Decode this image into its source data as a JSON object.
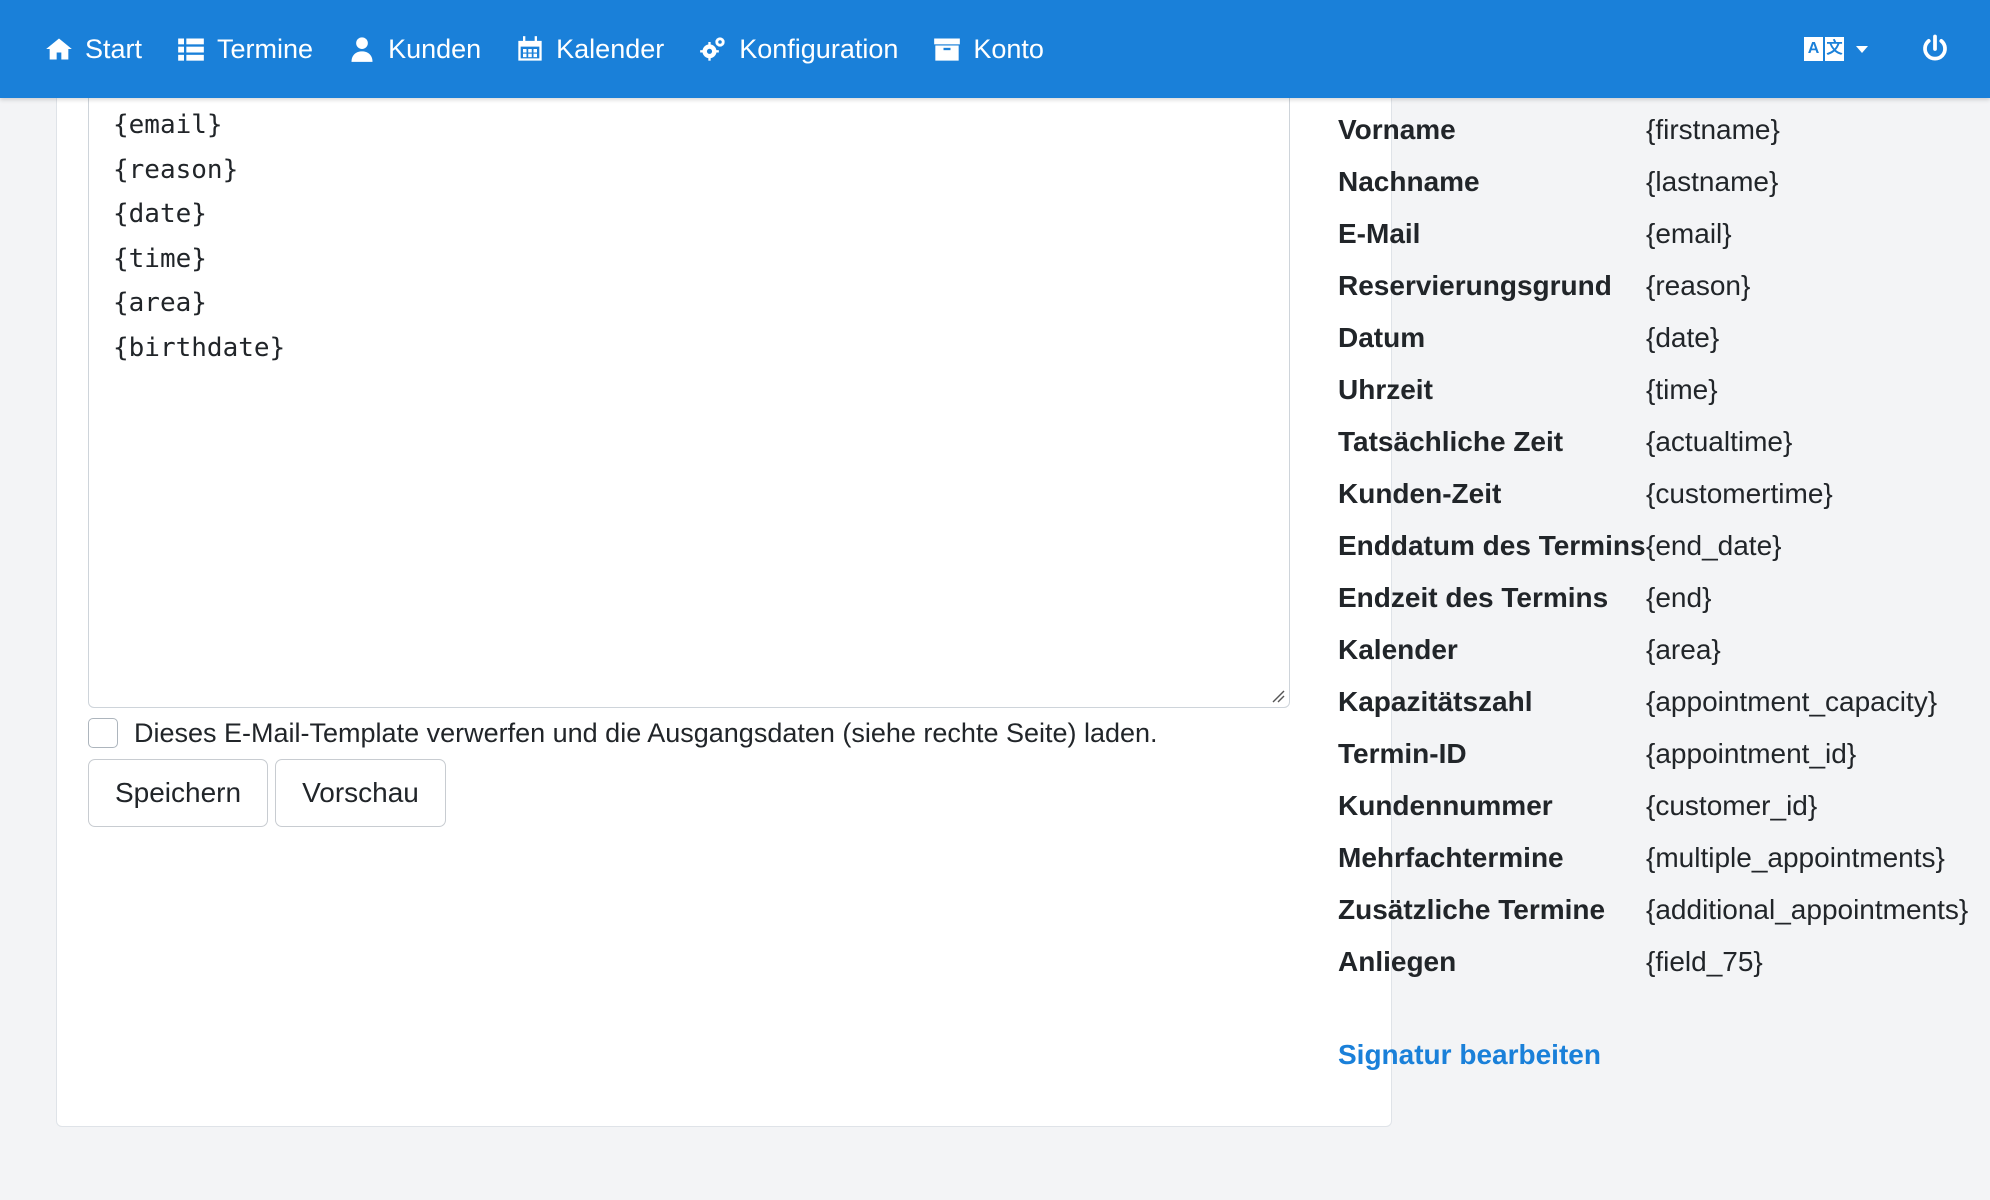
{
  "nav": {
    "items": [
      {
        "label": "Start",
        "icon": "home-icon"
      },
      {
        "label": "Termine",
        "icon": "list-icon"
      },
      {
        "label": "Kunden",
        "icon": "user-icon"
      },
      {
        "label": "Kalender",
        "icon": "calendar-icon"
      },
      {
        "label": "Konfiguration",
        "icon": "gears-icon"
      },
      {
        "label": "Konto",
        "icon": "archive-icon"
      }
    ],
    "language_icon": "language-icon",
    "logout_icon": "power-icon"
  },
  "editor": {
    "lines": [
      "{email}",
      "{reason}",
      "{date}",
      "{time}",
      "{area}",
      "{birthdate}"
    ],
    "reset_label": "Dieses E-Mail-Template verwerfen und die Ausgangsdaten (siehe rechte Seite) laden.",
    "save_label": "Speichern",
    "preview_label": "Vorschau"
  },
  "placeholders": [
    {
      "label": "Vorname",
      "value": "{firstname}"
    },
    {
      "label": "Nachname",
      "value": "{lastname}"
    },
    {
      "label": "E-Mail",
      "value": "{email}"
    },
    {
      "label": "Reservierungsgrund",
      "value": "{reason}"
    },
    {
      "label": "Datum",
      "value": "{date}"
    },
    {
      "label": "Uhrzeit",
      "value": "{time}"
    },
    {
      "label": "Tatsächliche Zeit",
      "value": "{actualtime}"
    },
    {
      "label": "Kunden-Zeit",
      "value": "{customertime}"
    },
    {
      "label": "Enddatum des Termins",
      "value": "{end_date}"
    },
    {
      "label": "Endzeit des Termins",
      "value": "{end}"
    },
    {
      "label": "Kalender",
      "value": "{area}"
    },
    {
      "label": "Kapazitätszahl",
      "value": "{appointment_capacity}"
    },
    {
      "label": "Termin-ID",
      "value": "{appointment_id}"
    },
    {
      "label": "Kundennummer",
      "value": "{customer_id}"
    },
    {
      "label": "Mehrfachtermine",
      "value": "{multiple_appointments}"
    },
    {
      "label": "Zusätzliche Termine",
      "value": "{additional_appointments}"
    },
    {
      "label": "Anliegen",
      "value": "{field_75}"
    }
  ],
  "signature_link": "Signatur bearbeiten",
  "colors": {
    "navbar": "#1a80d9",
    "link": "#1a80d9",
    "background": "#f3f4f6"
  }
}
